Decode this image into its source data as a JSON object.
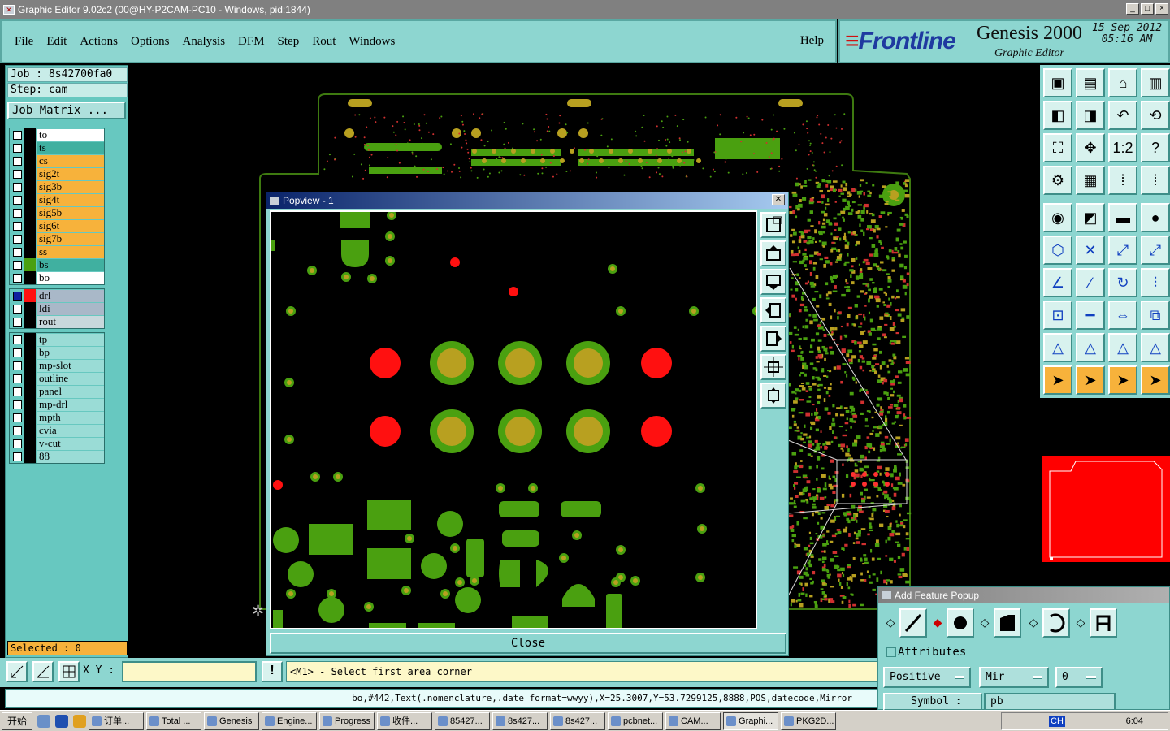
{
  "window": {
    "title": "Graphic Editor 9.02c2 (00@HY-P2CAM-PC10 - Windows, pid:1844)",
    "buttons": [
      "_",
      "□",
      "×"
    ]
  },
  "menu": {
    "items": [
      "File",
      "Edit",
      "Actions",
      "Options",
      "Analysis",
      "DFM",
      "Step",
      "Rout",
      "Windows"
    ],
    "help": "Help"
  },
  "brand": {
    "logo": "Frontline",
    "product": "Genesis 2000",
    "subtitle": "Graphic Editor",
    "date": "15 Sep 2012",
    "time": "05:16 AM"
  },
  "job": {
    "job": "Job : 8s42700fa0",
    "step": "Step: cam",
    "matrix_button": "Job Matrix ..."
  },
  "layers": {
    "board": [
      {
        "name": "to",
        "color": "#ffffff"
      },
      {
        "name": "ts",
        "color": "#40b0a0"
      },
      {
        "name": "cs",
        "color": "#f7b23b"
      },
      {
        "name": "sig2t",
        "color": "#f7b23b"
      },
      {
        "name": "sig3b",
        "color": "#f7b23b"
      },
      {
        "name": "sig4t",
        "color": "#f7b23b"
      },
      {
        "name": "sig5b",
        "color": "#f7b23b"
      },
      {
        "name": "sig6t",
        "color": "#f7b23b"
      },
      {
        "name": "sig7b",
        "color": "#f7b23b"
      },
      {
        "name": "ss",
        "color": "#f7b23b"
      },
      {
        "name": "bs",
        "color": "#40b0a0"
      },
      {
        "name": "bo",
        "color": "#ffffff"
      }
    ],
    "drill": [
      {
        "name": "drl",
        "color": "#a9b8c8"
      },
      {
        "name": "ldi",
        "color": "#a9b8c8"
      },
      {
        "name": "rout",
        "color": "#c8d8dc"
      }
    ],
    "misc": [
      {
        "name": "tp"
      },
      {
        "name": "bp"
      },
      {
        "name": "mp-slot"
      },
      {
        "name": "outline"
      },
      {
        "name": "panel"
      },
      {
        "name": "mp-drl"
      },
      {
        "name": "mpth"
      },
      {
        "name": "cvia"
      },
      {
        "name": "v-cut"
      },
      {
        "name": "88"
      }
    ]
  },
  "selected": "Selected : 0",
  "popview": {
    "title": "Popview - 1",
    "close_label": "Close"
  },
  "bottom": {
    "xy_label": "X Y :",
    "xy_value": "",
    "prompt": "<M1> - Select first area corner",
    "info_label": "!"
  },
  "status": "bo,#442,Text(.nomenclature,.date_format=wwyy),X=25.3007,Y=53.7299125,8888,POS,datecode,Mirror",
  "add_feature": {
    "title": "Add Feature Popup",
    "attributes_label": "Attributes",
    "polarity": "Positive",
    "mirror": "Mir",
    "angle": "0",
    "symbol_label": "Symbol :",
    "symbol_value": "pb"
  },
  "taskbar": {
    "start": "开始",
    "tasks": [
      "订单...",
      "Total ...",
      "Genesis",
      "Engine...",
      "Progress",
      "收件...",
      "85427...",
      "8s427...",
      "8s427...",
      "pcbnet...",
      "CAM...",
      "Graphi...",
      "PKG2D..."
    ],
    "active_task": "Graphi...",
    "clock": "6:04",
    "tray_ch": "CH"
  },
  "colors": {
    "panel": "#8dd6d0",
    "layer_panel": "#67c8c0",
    "accent_red": "#ff0000",
    "copper_green": "#4aa010",
    "pad_gold": "#b8a020"
  }
}
